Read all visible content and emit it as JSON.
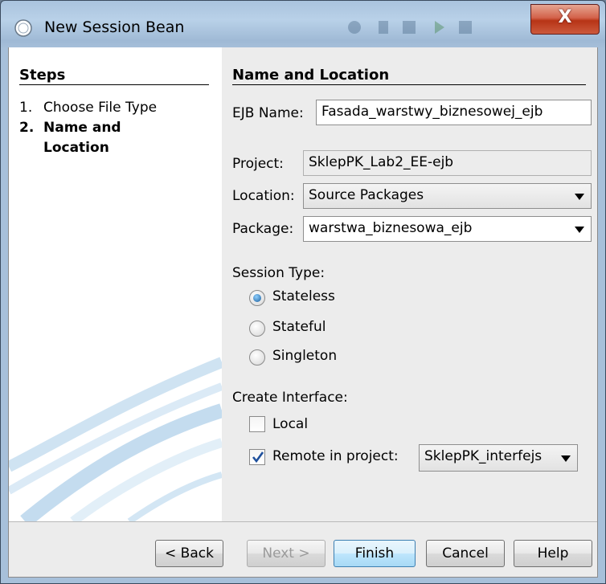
{
  "window": {
    "title": "New Session Bean",
    "close_label": "X"
  },
  "steps": {
    "heading": "Steps",
    "items": [
      {
        "num": "1.",
        "label": "Choose File Type"
      },
      {
        "num": "2.",
        "label_line1": "Name and",
        "label_line2": "Location"
      }
    ]
  },
  "form": {
    "heading": "Name and Location",
    "ejb_name": {
      "label": "EJB Name:",
      "value": "Fasada_warstwy_biznesowej_ejb"
    },
    "project": {
      "label": "Project:",
      "value": "SklepPK_Lab2_EE-ejb"
    },
    "location": {
      "label": "Location:",
      "value": "Source Packages"
    },
    "package": {
      "label": "Package:",
      "value": "warstwa_biznesowa_ejb"
    },
    "session_type": {
      "label": "Session Type:",
      "options": [
        "Stateless",
        "Stateful",
        "Singleton"
      ],
      "selected": "Stateless"
    },
    "create_interface": {
      "label": "Create Interface:",
      "local": {
        "label": "Local",
        "checked": false
      },
      "remote": {
        "label": "Remote in project:",
        "checked": true,
        "project": "SklepPK_interfejs"
      }
    }
  },
  "buttons": {
    "back": "< Back",
    "next": "Next >",
    "finish": "Finish",
    "cancel": "Cancel",
    "help": "Help"
  }
}
